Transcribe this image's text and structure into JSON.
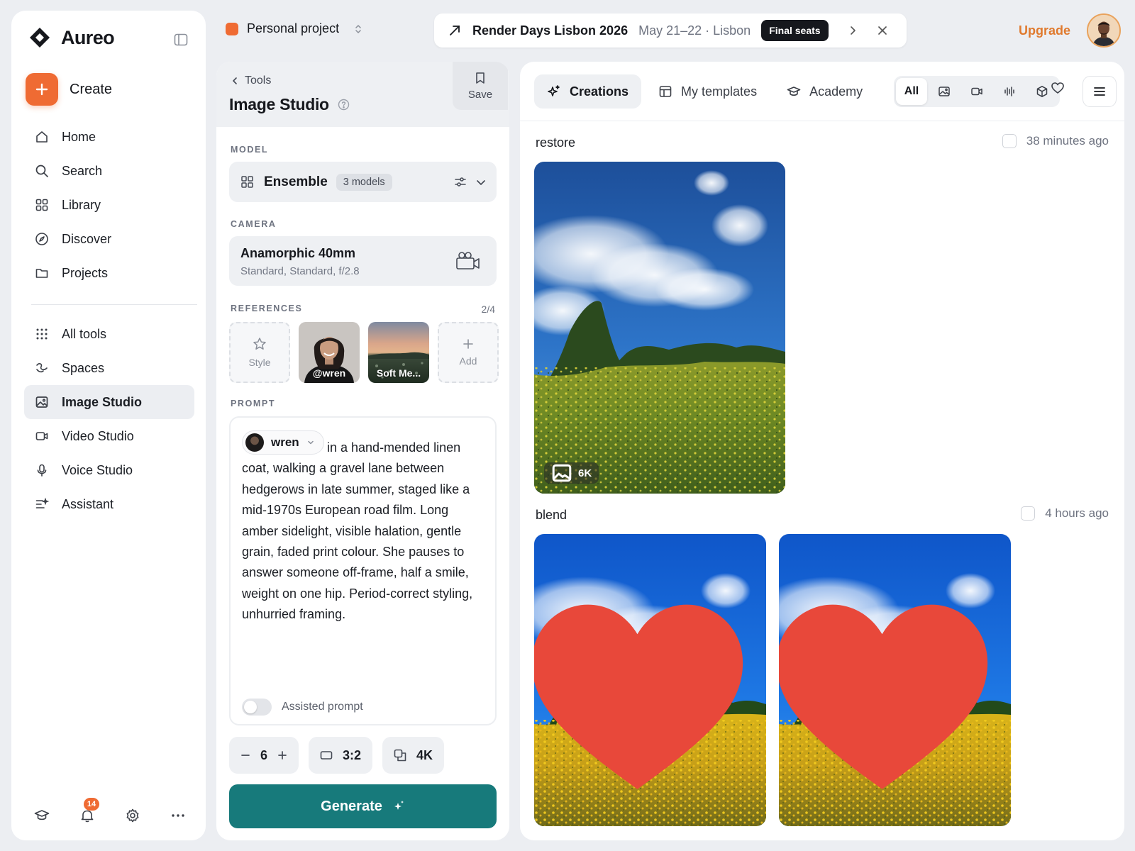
{
  "app": {
    "name": "Aureo"
  },
  "sidebar": {
    "create_label": "Create",
    "primary": [
      {
        "label": "Home",
        "icon": "home-icon"
      },
      {
        "label": "Search",
        "icon": "search-icon"
      },
      {
        "label": "Library",
        "icon": "library-icon"
      },
      {
        "label": "Discover",
        "icon": "compass-icon"
      },
      {
        "label": "Projects",
        "icon": "folder-icon"
      }
    ],
    "tools": [
      {
        "label": "All tools",
        "icon": "grid-dots-icon"
      },
      {
        "label": "Spaces",
        "icon": "spaces-icon"
      },
      {
        "label": "Image Studio",
        "icon": "image-icon",
        "active": true
      },
      {
        "label": "Video Studio",
        "icon": "video-icon"
      },
      {
        "label": "Voice Studio",
        "icon": "microphone-icon"
      },
      {
        "label": "Assistant",
        "icon": "assistant-icon"
      }
    ],
    "notifications_count": "14"
  },
  "topbar": {
    "project_name": "Personal project",
    "banner": {
      "title": "Render Days Lisbon 2026",
      "subtitle": "May 21–22 · Lisbon",
      "badge": "Final seats"
    },
    "upgrade_label": "Upgrade"
  },
  "studio": {
    "back_label": "Tools",
    "title": "Image Studio",
    "save_label": "Save",
    "model": {
      "section_label": "MODEL",
      "name": "Ensemble",
      "badge": "3 models"
    },
    "camera": {
      "section_label": "CAMERA",
      "name": "Anamorphic 40mm",
      "details": "Standard, Standard, f/2.8"
    },
    "references": {
      "section_label": "REFERENCES",
      "count": "2/4",
      "style_label": "Style",
      "items": [
        {
          "label": "@wren"
        },
        {
          "label": "Soft Me..."
        }
      ],
      "add_label": "Add"
    },
    "prompt": {
      "section_label": "PROMPT",
      "mention": "wren",
      "text": "in a hand-mended linen coat, walking a gravel lane between hedgerows in late summer, staged like a mid-1970s European road film. Long amber sidelight, visible halation, gentle grain, faded print colour. She pauses to answer someone off-frame, half a smile, weight on one hip. Period-correct styling, unhurried framing.",
      "assisted_label": "Assisted prompt",
      "assisted_on": false
    },
    "options": {
      "count": "6",
      "aspect": "3:2",
      "resolution": "4K"
    },
    "generate_label": "Generate"
  },
  "gallery": {
    "tabs": [
      {
        "label": "Creations",
        "icon": "sparkle-icon",
        "active": true
      },
      {
        "label": "My templates",
        "icon": "template-icon"
      },
      {
        "label": "Academy",
        "icon": "graduation-cap-icon"
      }
    ],
    "filters": {
      "all_label": "All",
      "icons": [
        "image-filter-icon",
        "video-filter-icon",
        "audio-filter-icon",
        "3d-filter-icon"
      ]
    },
    "groups": [
      {
        "title": "restore",
        "time": "38 minutes ago",
        "items": [
          {
            "resolution": "6K",
            "favorite": false
          }
        ]
      },
      {
        "title": "blend",
        "time": "4 hours ago",
        "items": [
          {
            "favorite": true
          },
          {
            "favorite": true
          }
        ]
      }
    ]
  },
  "colors": {
    "accent": "#ef6b33",
    "upgrade": "#e07a2e",
    "generate": "#177a7b",
    "favorite": "#e8483a"
  }
}
